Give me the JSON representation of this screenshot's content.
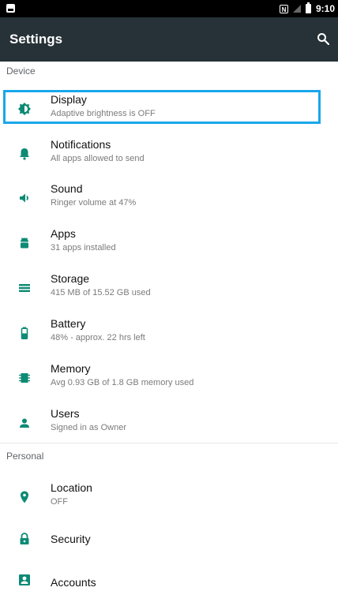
{
  "status_bar": {
    "time": "9:10"
  },
  "app_bar": {
    "title": "Settings"
  },
  "sections": {
    "device": "Device",
    "personal": "Personal"
  },
  "items": [
    {
      "title": "Display",
      "subtitle": "Adaptive brightness is OFF",
      "icon": "display-brightness-icon"
    },
    {
      "title": "Notifications",
      "subtitle": "All apps allowed to send",
      "icon": "bell-icon"
    },
    {
      "title": "Sound",
      "subtitle": "Ringer volume at 47%",
      "icon": "volume-icon"
    },
    {
      "title": "Apps",
      "subtitle": "31 apps installed",
      "icon": "android-icon"
    },
    {
      "title": "Storage",
      "subtitle": "415 MB of 15.52 GB used",
      "icon": "storage-icon"
    },
    {
      "title": "Battery",
      "subtitle": "48% - approx. 22 hrs left",
      "icon": "battery-icon"
    },
    {
      "title": "Memory",
      "subtitle": "Avg 0.93 GB of 1.8 GB memory used",
      "icon": "memory-icon"
    },
    {
      "title": "Users",
      "subtitle": "Signed in as Owner",
      "icon": "user-icon"
    },
    {
      "title": "Location",
      "subtitle": "OFF",
      "icon": "location-icon"
    },
    {
      "title": "Security",
      "subtitle": "",
      "icon": "lock-icon"
    },
    {
      "title": "Accounts",
      "subtitle": "",
      "icon": "account-icon"
    }
  ],
  "colors": {
    "accent": "#0C8A74",
    "app_bar": "#263238",
    "highlight": "#19A7EA"
  }
}
